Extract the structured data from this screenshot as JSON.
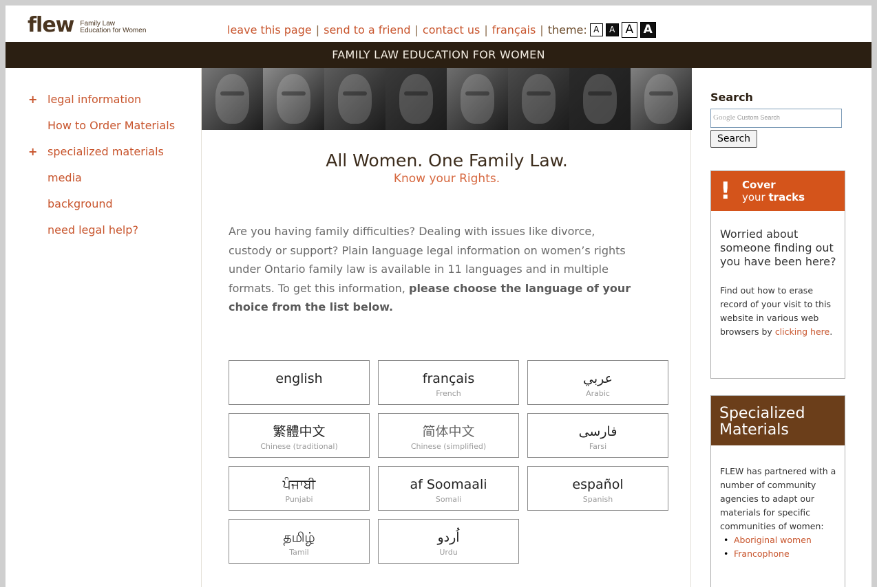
{
  "logo": {
    "word": "flew",
    "tagline_line1": "Family Law",
    "tagline_line2": "Education for Women"
  },
  "topnav": {
    "links": [
      "leave this page",
      "send to a friend",
      "contact us",
      "français"
    ],
    "separator": "|",
    "theme_label": "theme:",
    "theme_buttons": [
      "A",
      "A",
      "A",
      "A"
    ]
  },
  "banner": "FAMILY LAW EDUCATION FOR WOMEN",
  "leftnav": {
    "items": [
      {
        "label": "legal information",
        "expandable": true,
        "expand_glyph": "+"
      },
      {
        "label": "How to Order Materials",
        "expandable": false
      },
      {
        "label": "specialized materials",
        "expandable": true,
        "expand_glyph": "+"
      },
      {
        "label": "media",
        "expandable": false
      },
      {
        "label": "background",
        "expandable": false
      },
      {
        "label": "need legal help?",
        "expandable": false
      }
    ]
  },
  "hero": {
    "photos": [
      "#777",
      "#8a8a8a",
      "#5c5c5c",
      "#3a3a3a",
      "#6e6e6e",
      "#4a4a4a",
      "#2a2a2a",
      "#808080"
    ]
  },
  "tagline": {
    "title": "All Women. One Family Law.",
    "subtitle": "Know your Rights."
  },
  "intro": {
    "text": "Are you having family difficulties? Dealing with issues like divorce, custody or support? Plain language legal information on women’s rights under Ontario family law is available in 11 languages and in multiple formats. To get this information, ",
    "bold": "please choose the language of your choice from the list below."
  },
  "languages": [
    {
      "native": "english",
      "english": ""
    },
    {
      "native": "français",
      "english": "French"
    },
    {
      "native": "عربي",
      "english": "Arabic"
    },
    {
      "native": "繁體中文",
      "english": "Chinese (traditional)"
    },
    {
      "native": "简体中文",
      "english": "Chinese (simplified)"
    },
    {
      "native": "فارسی",
      "english": "Farsi"
    },
    {
      "native": "ਪੰਜਾਬੀ",
      "english": "Punjabi"
    },
    {
      "native": "af Soomaali",
      "english": "Somali"
    },
    {
      "native": "español",
      "english": "Spanish"
    },
    {
      "native": "தமிழ்",
      "english": "Tamil"
    },
    {
      "native": "اُردو",
      "english": "Urdu"
    }
  ],
  "search": {
    "title": "Search",
    "placeholder_brand": "Google",
    "placeholder": "Custom Search",
    "button": "Search"
  },
  "cover_tracks": {
    "glyph": "!",
    "title_bold": "Cover",
    "title_rest": "your",
    "title_bold2": "tracks",
    "question": "Worried about someone finding out you have been here?",
    "desc": "Find out how to erase record of your visit to this website in various web browsers by ",
    "link": "clicking here",
    "desc_end": "."
  },
  "specialized": {
    "title": "Specialized Materials",
    "body": "FLEW has partnered with a number of community agencies to adapt our materials for specific communities of women:",
    "items": [
      "Aboriginal women",
      "Francophone"
    ]
  },
  "colors": {
    "accent": "#c8552d",
    "banner": "#2b1f12",
    "cover": "#d4541b",
    "specialized": "#6b3e1a"
  }
}
